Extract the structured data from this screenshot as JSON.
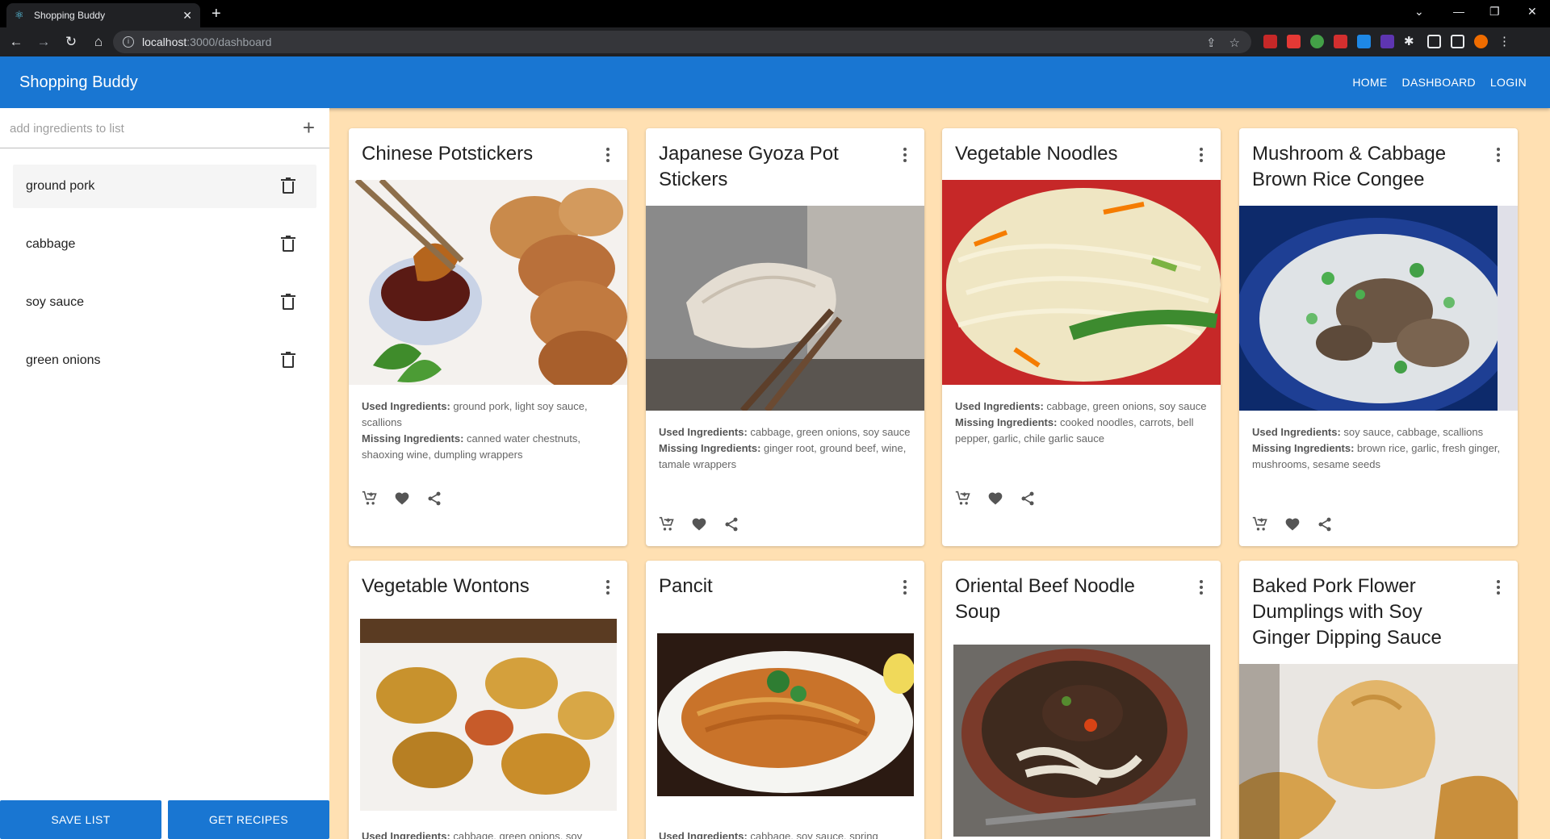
{
  "browser": {
    "tab_title": "Shopping Buddy",
    "url_host": "localhost",
    "url_rest": ":3000/dashboard"
  },
  "app": {
    "title": "Shopping Buddy",
    "nav": [
      "HOME",
      "DASHBOARD",
      "LOGIN"
    ]
  },
  "sidebar": {
    "input_placeholder": "add ingredients to list",
    "ingredients": [
      "ground pork",
      "cabbage",
      "soy sauce",
      "green onions"
    ],
    "save_label": "SAVE LIST",
    "recipes_label": "GET RECIPES"
  },
  "labels": {
    "used": "Used Ingredients:",
    "missing": "Missing Ingredients:"
  },
  "recipes": [
    {
      "title": "Chinese Potstickers",
      "used": "ground pork, light soy sauce, scallions",
      "missing": "canned water chestnuts, shaoxing wine, dumpling wrappers"
    },
    {
      "title": "Japanese Gyoza Pot Stickers",
      "used": "cabbage, green onions, soy sauce",
      "missing": "ginger root, ground beef, wine, tamale wrappers"
    },
    {
      "title": "Vegetable Noodles",
      "used": "cabbage, green onions, soy sauce",
      "missing": "cooked noodles, carrots, bell pepper, garlic, chile garlic sauce"
    },
    {
      "title": "Mushroom & Cabbage Brown Rice Congee",
      "used": "soy sauce, cabbage, scallions",
      "missing": "brown rice, garlic, fresh ginger, mushrooms, sesame seeds"
    },
    {
      "title": "Vegetable Wontons",
      "used": "cabbage, green onions, soy",
      "missing": ""
    },
    {
      "title": "Pancit",
      "used": "cabbage, soy sauce, spring",
      "missing": ""
    },
    {
      "title": "Oriental Beef Noodle Soup",
      "used": "",
      "missing": ""
    },
    {
      "title": "Baked Pork Flower Dumplings with Soy Ginger Dipping Sauce",
      "used": "",
      "missing": ""
    }
  ],
  "colors": {
    "primary": "#1976d2",
    "background": "#ffe0b2"
  }
}
